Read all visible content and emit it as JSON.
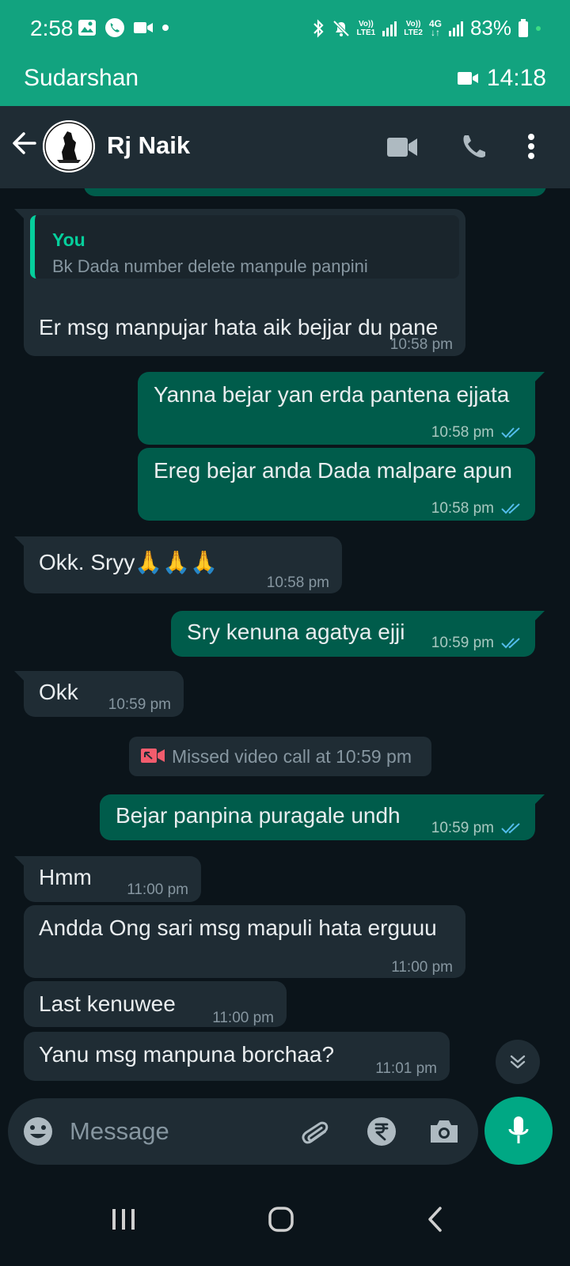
{
  "status_bar": {
    "time": "2:58",
    "battery": "83%",
    "sim1_label_top": "Vo))",
    "sim1_label_bottom": "LTE1",
    "sim2_label_top": "Vo))",
    "sim2_label_bottom": "LTE2",
    "network_type": "4G"
  },
  "call_banner": {
    "name": "Sudarshan",
    "timer": "14:18"
  },
  "header": {
    "contact_name": "Rj Naik"
  },
  "messages": [
    {
      "direction": "in",
      "quote_author": "You",
      "quote_text": "Bk Dada number delete manpule panpini",
      "text": "Er msg manpujar hata aik bejjar du pane",
      "time": "10:58 pm"
    },
    {
      "direction": "out",
      "text": "Yanna bejar yan erda pantena ejjata",
      "time": "10:58 pm",
      "status": "read"
    },
    {
      "direction": "out",
      "text": "Ereg bejar anda Dada malpare apun",
      "time": "10:58 pm",
      "status": "read"
    },
    {
      "direction": "in",
      "text": "Okk. Sryy🙏🙏🙏",
      "time": "10:58 pm"
    },
    {
      "direction": "out",
      "text": "Sry kenuna agatya ejji",
      "time": "10:59 pm",
      "status": "read"
    },
    {
      "direction": "in",
      "text": "Okk",
      "time": "10:59 pm"
    },
    {
      "direction": "system",
      "text": "Missed video call at 10:59 pm"
    },
    {
      "direction": "out",
      "text": "Bejar panpina puragale undh",
      "time": "10:59 pm",
      "status": "read"
    },
    {
      "direction": "in",
      "text": "Hmm",
      "time": "11:00 pm"
    },
    {
      "direction": "in",
      "text": "Andda Ong sari msg mapuli hata erguuu",
      "time": "11:00 pm"
    },
    {
      "direction": "in",
      "text": "Last kenuwee",
      "time": "11:00 pm"
    },
    {
      "direction": "in",
      "text": "Yanu msg manpuna borchaa?",
      "time": "11:01 pm"
    }
  ],
  "composer": {
    "placeholder": "Message"
  },
  "colors": {
    "brand_green": "#12a37f",
    "outgoing_bubble": "#005c4b",
    "incoming_bubble": "#1f2c34",
    "background": "#0b141a",
    "read_ticks": "#53bdeb",
    "missed_call": "#f15c6d"
  },
  "icons": {
    "back": "arrow-left-icon",
    "video": "video-camera-icon",
    "call": "phone-icon",
    "menu": "more-vert-icon",
    "emoji": "emoji-icon",
    "attach": "paperclip-icon",
    "payment": "rupee-icon",
    "camera": "camera-icon",
    "mic": "mic-icon",
    "scroll": "double-chevron-down-icon"
  }
}
